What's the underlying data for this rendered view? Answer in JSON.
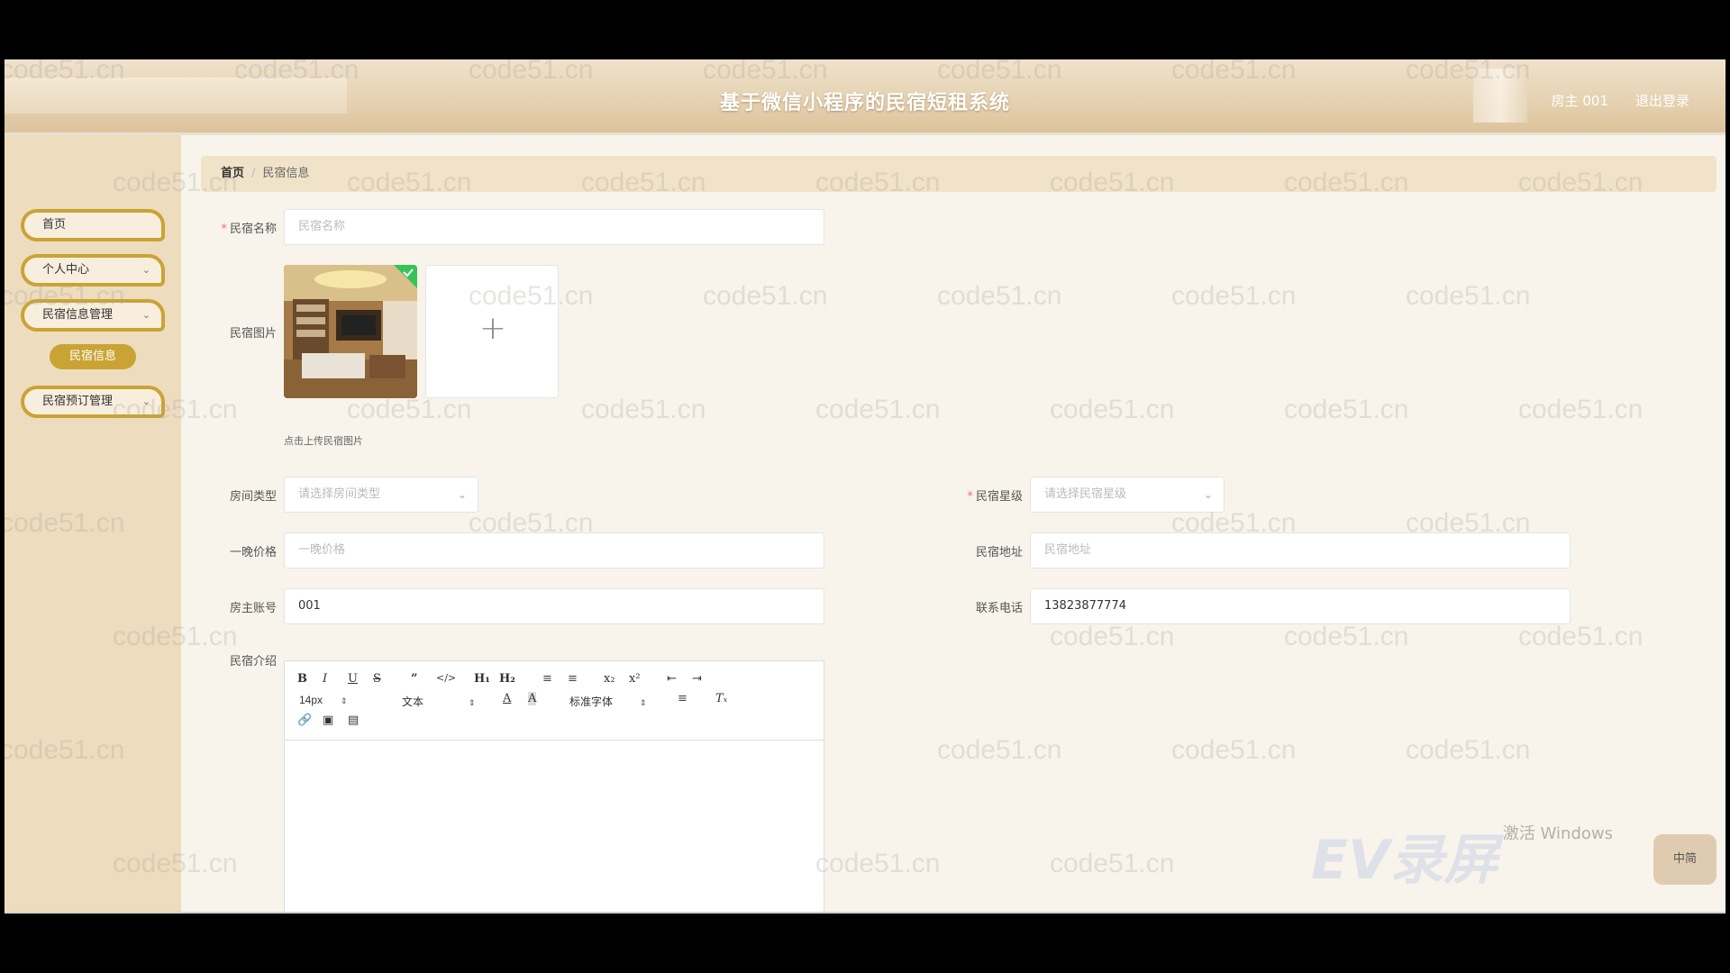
{
  "header": {
    "title": "基于微信小程序的民宿短租系统",
    "user": "房主 001",
    "logout": "退出登录"
  },
  "sidebar": {
    "items": [
      {
        "label": "首页"
      },
      {
        "label": "个人中心"
      },
      {
        "label": "民宿信息管理"
      },
      {
        "label": "民宿信息"
      },
      {
        "label": "民宿预订管理"
      }
    ]
  },
  "breadcrumb": {
    "home": "首页",
    "sep": "/",
    "current": "民宿信息"
  },
  "form": {
    "name": {
      "label": "民宿名称",
      "placeholder": "民宿名称",
      "value": ""
    },
    "image": {
      "label": "民宿图片",
      "tip": "点击上传民宿图片"
    },
    "room_type": {
      "label": "房间类型",
      "placeholder": "请选择房间类型"
    },
    "star": {
      "label": "民宿星级",
      "placeholder": "请选择民宿星级"
    },
    "price": {
      "label": "一晚价格",
      "placeholder": "一晚价格"
    },
    "address": {
      "label": "民宿地址",
      "placeholder": "民宿地址"
    },
    "owner_account": {
      "label": "房主账号",
      "value": "001"
    },
    "phone": {
      "label": "联系电话",
      "value": "13823877774"
    },
    "intro": {
      "label": "民宿介绍"
    }
  },
  "editor": {
    "font_size": "14px",
    "format": "文本",
    "font": "标准字体"
  },
  "watermark": "code51.cn",
  "overlay": {
    "win_activate": "激活 Windows",
    "ev": "EV录屏",
    "ime": "中简"
  },
  "colors": {
    "accent": "#c9a434",
    "sidebar_bg": "#eedcbf",
    "required": "#f56c6c"
  }
}
